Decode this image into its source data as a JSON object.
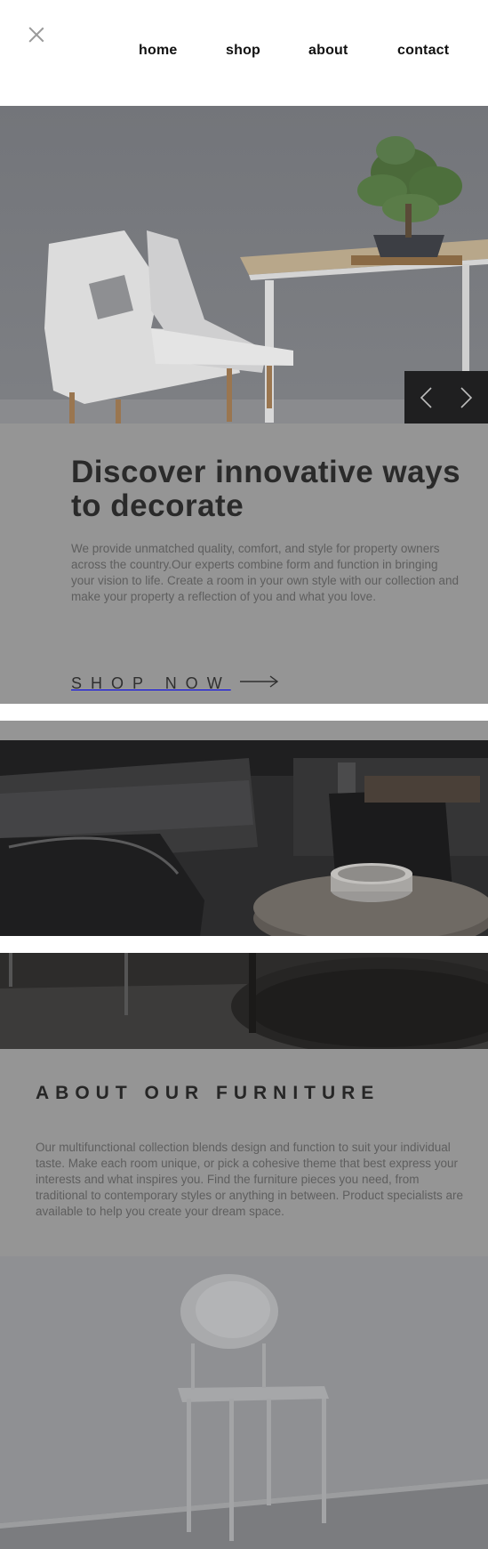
{
  "nav": {
    "close_label": "close",
    "items": [
      {
        "label": "home"
      },
      {
        "label": "shop"
      },
      {
        "label": "about"
      },
      {
        "label": "contact"
      }
    ]
  },
  "hero": {
    "image": "white-chair-table-bonsai",
    "prev_icon": "chevron-left-icon",
    "next_icon": "chevron-right-icon"
  },
  "discover": {
    "title": "Discover innovative ways to decorate",
    "text": "We provide unmatched quality, comfort, and style for property owners across the country.Our experts combine form and function in bringing your vision to life. Create a room in your own style with our collection and make your property a reflection of you and what you love.",
    "cta_label": "SHOP NOW",
    "cta_icon": "arrow-right-icon"
  },
  "gallery": {
    "image_top": "dark-living-room",
    "image_bottom": "dark-living-room-floor"
  },
  "about": {
    "title": "ABOUT OUR FURNITURE",
    "text": "Our multifunctional collection blends design and function to suit your individual taste. Make each room unique, or pick a cohesive theme that best express your interests and what inspires you. Find the furniture pieces you need, from traditional to contemporary styles or anything in between. Product specialists are available to help you create your dream space."
  },
  "footer_image": "white-chair-gray-wall",
  "colors": {
    "overlay_gray": "#959595",
    "heading": "#2a2a2a",
    "body_text": "#5e5e5e",
    "arrow_box": "#1f1f20"
  }
}
